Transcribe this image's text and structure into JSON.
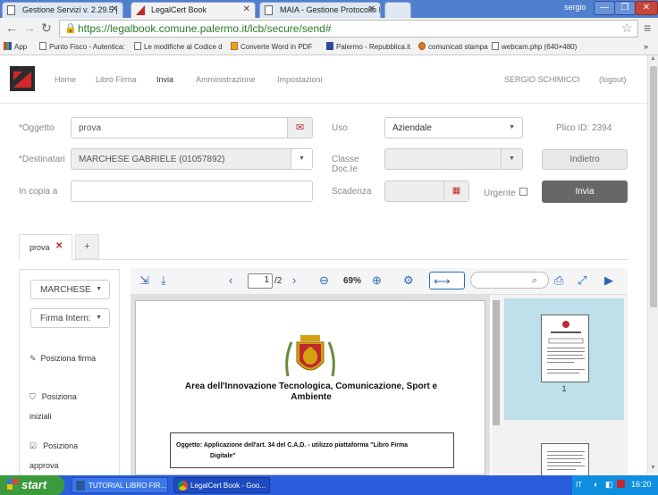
{
  "browser": {
    "tabs": [
      {
        "label": "Gestione Servizi v. 2.29.5 |"
      },
      {
        "label": "LegalCert Book"
      },
      {
        "label": "MAIA - Gestione Protocollo In"
      }
    ],
    "user": "sergio",
    "url": "https://legalbook.comune.palermo.it/lcb/secure/send#",
    "bookmarks": [
      "App",
      "Punto Fisco - Autentica:",
      "Le modifiche al Codice d",
      "Converte Word in PDF",
      "Palermo - Repubblica.it",
      "comunicati stampa",
      "webcam.php (640×480)"
    ]
  },
  "nav": {
    "items": [
      "Home",
      "Libro Firma",
      "Invia",
      "Amministrazione",
      "Impostazioni"
    ],
    "user": "SERGIO SCHIMICCI",
    "logout": "(logout)"
  },
  "form": {
    "oggetto_label": "*Oggetto",
    "oggetto_value": "prova",
    "uso_label": "Uso",
    "uso_value": "Aziendale",
    "plico": "Plico ID: 2394",
    "destinatari_label": "*Destinatari",
    "destinatari_value": "MARCHESE GABRIELE (01057892)",
    "classe_label_1": "Classe",
    "classe_label_2": "Doc.Ie",
    "indietro": "Indietro",
    "copia_label": "In copia a",
    "scadenza_label": "Scadenza",
    "urgente_label": "Urgente",
    "invia": "Invia"
  },
  "doc_tabs": {
    "tab_label": "prova",
    "add": "+"
  },
  "sidebar": {
    "select1": "MARCHESE",
    "select2": "Firma Intern:",
    "item1": "Posiziona firma",
    "item2a": "Posiziona",
    "item2b": "iniziali",
    "item3a": "Posiziona",
    "item3b": "approva"
  },
  "viewer": {
    "page_value": "1",
    "page_total": "/2",
    "zoom": "69%",
    "thumb_label": "1"
  },
  "document": {
    "heading_1": "Area dell'Innovazione Tecnologica, Comunicazione, Sport e",
    "heading_2": "Ambiente",
    "oggetto_line_1": "Oggetto: Applicazione dell'art. 34 del C.A.D. - utilizzo piattaforma \"Libro Firma",
    "oggetto_line_2": "Digitale\""
  },
  "taskbar": {
    "start": "start",
    "item1": "TUTORIAL LIBRO FIR...",
    "item2": "LegalCert Book - Goo...",
    "lang": "IT",
    "time": "16:20"
  }
}
